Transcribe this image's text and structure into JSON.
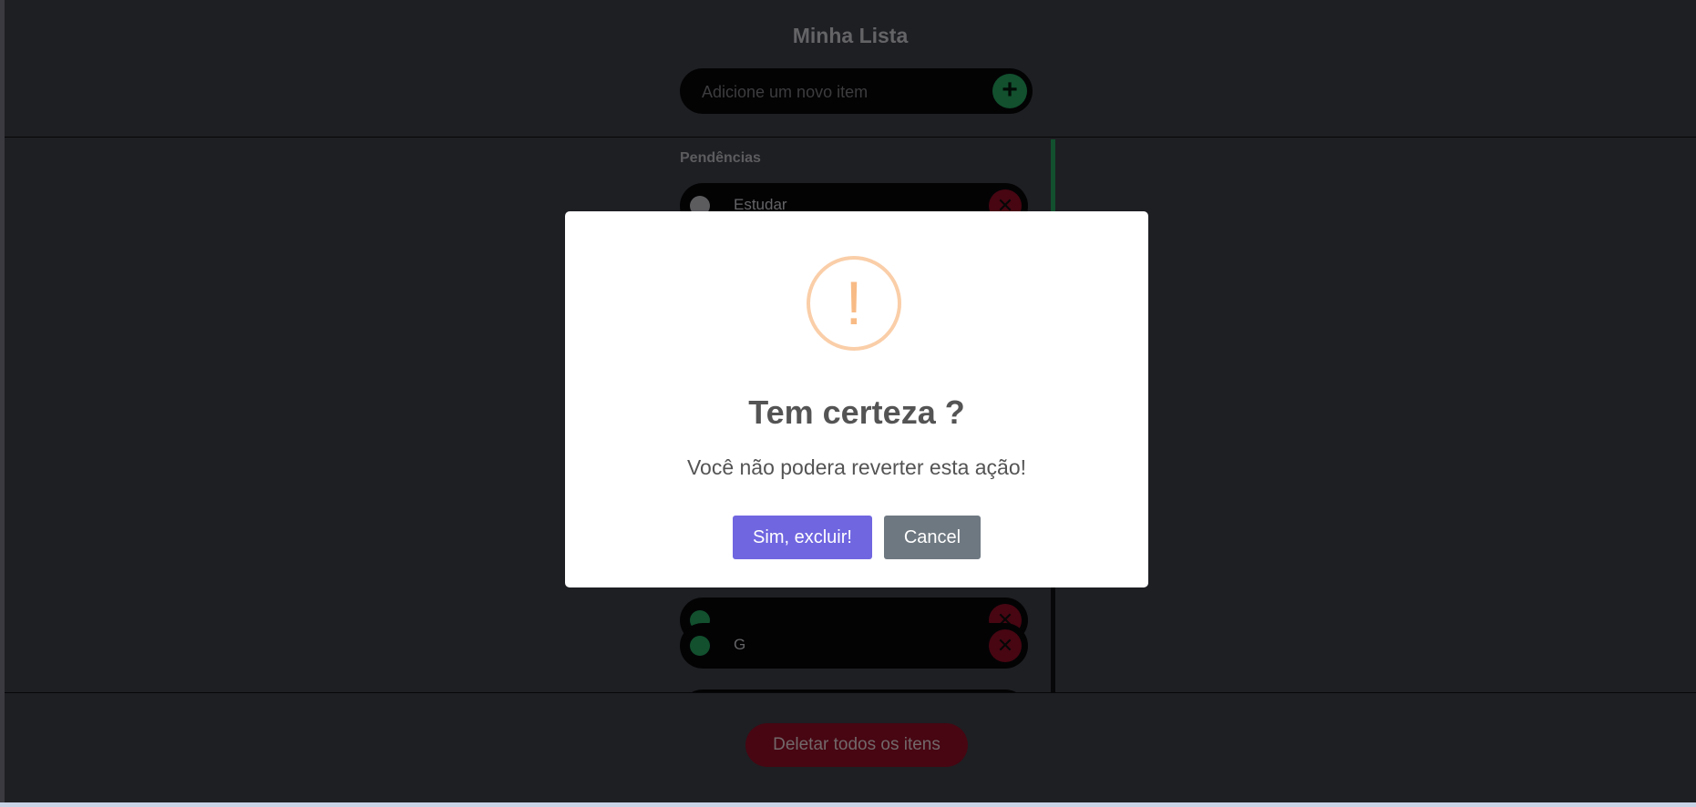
{
  "app": {
    "title": "Minha Lista",
    "add_input": {
      "placeholder": "Adicione um novo item",
      "value": ""
    },
    "add_button_icon": "plus-icon"
  },
  "list": {
    "section_label": "Pendências",
    "items": [
      {
        "text": "Estudar",
        "done": false
      },
      {
        "text": "",
        "done": true
      },
      {
        "text": "G",
        "done": true
      }
    ],
    "delete_icon": "close-icon"
  },
  "footer": {
    "delete_all_label": "Deletar todos os itens"
  },
  "modal": {
    "icon": "warning-icon",
    "icon_glyph": "!",
    "title": "Tem certeza ?",
    "text": "Você não podera reverter esta ação!",
    "confirm_label": "Sim, excluir!",
    "cancel_label": "Cancel"
  },
  "colors": {
    "background": "#2f3036",
    "bar": "#050507",
    "accent_green": "#1d7b47",
    "danger": "#6e0a1c",
    "confirm": "#7066e0",
    "cancel": "#6e7881",
    "warning": "#f8bb86"
  }
}
